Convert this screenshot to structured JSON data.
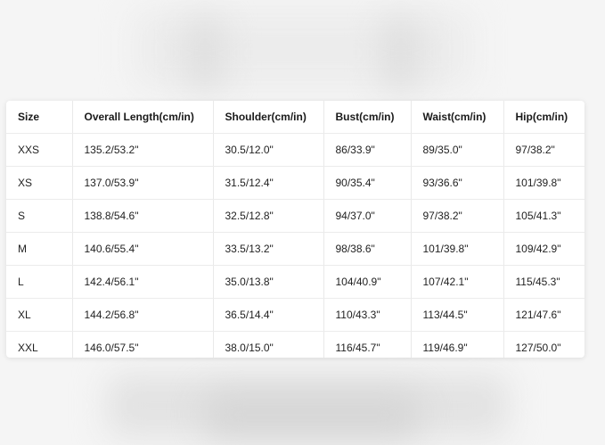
{
  "size_chart": {
    "headers": [
      "Size",
      "Overall Length(cm/in)",
      "Shoulder(cm/in)",
      "Bust(cm/in)",
      "Waist(cm/in)",
      "Hip(cm/in)"
    ],
    "rows": [
      [
        "XXS",
        "135.2/53.2\"",
        "30.5/12.0\"",
        "86/33.9\"",
        "89/35.0\"",
        "97/38.2\""
      ],
      [
        "XS",
        "137.0/53.9\"",
        "31.5/12.4\"",
        "90/35.4\"",
        "93/36.6\"",
        "101/39.8\""
      ],
      [
        "S",
        "138.8/54.6\"",
        "32.5/12.8\"",
        "94/37.0\"",
        "97/38.2\"",
        "105/41.3\""
      ],
      [
        "M",
        "140.6/55.4\"",
        "33.5/13.2\"",
        "98/38.6\"",
        "101/39.8\"",
        "109/42.9\""
      ],
      [
        "L",
        "142.4/56.1\"",
        "35.0/13.8\"",
        "104/40.9\"",
        "107/42.1\"",
        "115/45.3\""
      ],
      [
        "XL",
        "144.2/56.8\"",
        "36.5/14.4\"",
        "110/43.3\"",
        "113/44.5\"",
        "121/47.6\""
      ],
      [
        "XXL",
        "146.0/57.5\"",
        "38.0/15.0\"",
        "116/45.7\"",
        "119/46.9\"",
        "127/50.0\""
      ]
    ]
  }
}
